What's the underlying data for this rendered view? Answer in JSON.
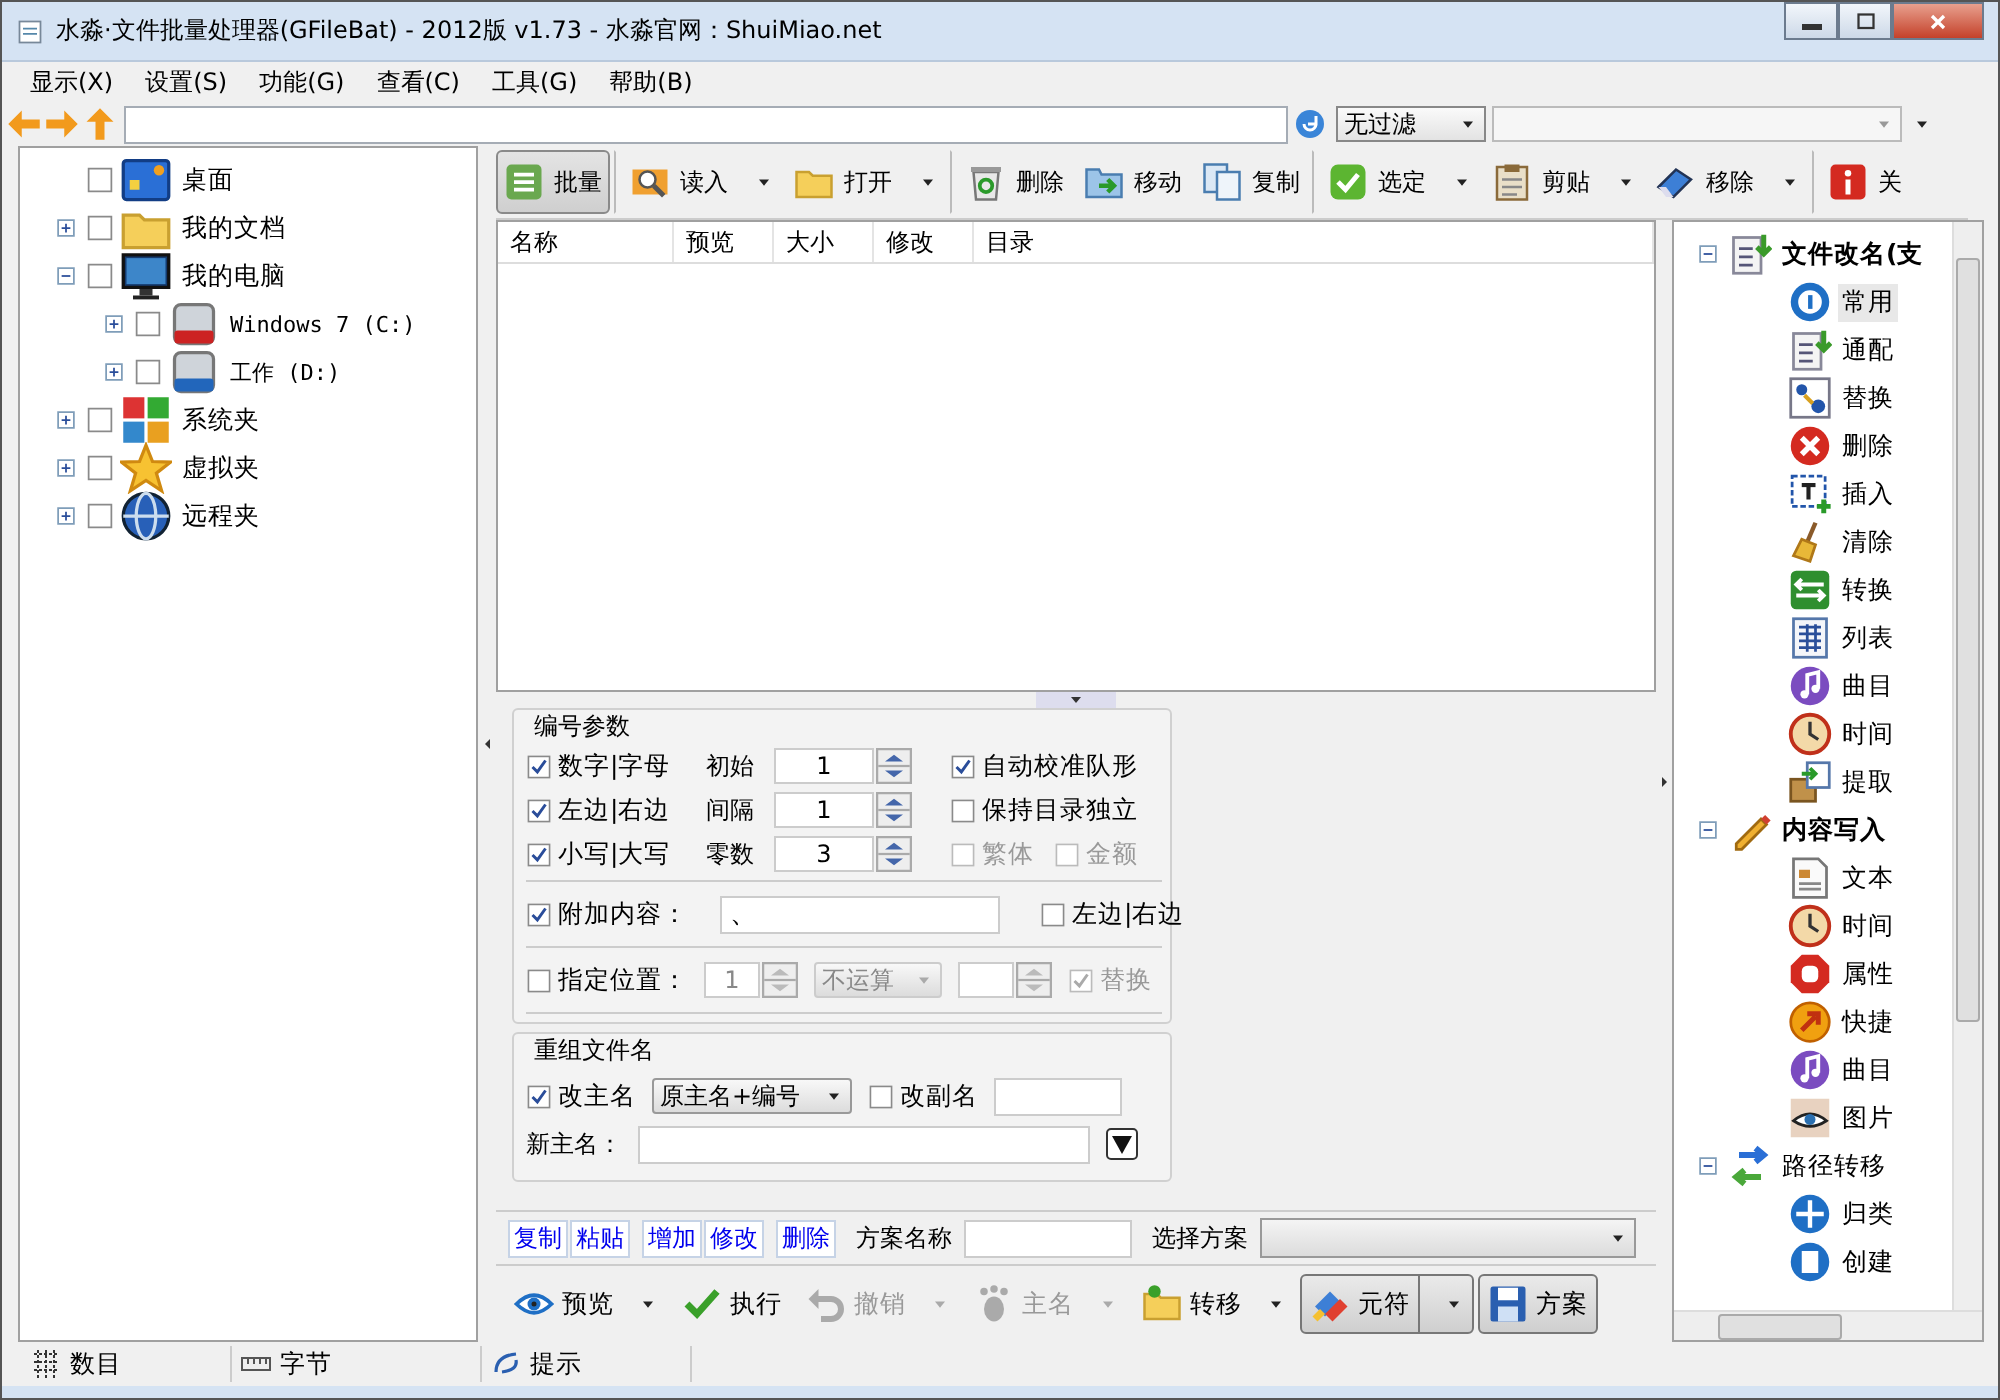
{
  "window": {
    "title": "水淼·文件批量处理器(GFileBat) - 2012版 v1.73 - 水淼官网：ShuiMiao.net"
  },
  "menu": [
    "显示(X)",
    "设置(S)",
    "功能(G)",
    "查看(C)",
    "工具(G)",
    "帮助(B)"
  ],
  "filter": {
    "value": "无过滤"
  },
  "folder_tree": [
    {
      "label": "桌面",
      "kind": "desktop",
      "checked": false
    },
    {
      "label": "我的文档",
      "kind": "folder",
      "checked": false,
      "expanded": false
    },
    {
      "label": "我的电脑",
      "kind": "monitor",
      "checked": false,
      "expanded": true,
      "children": [
        {
          "label": "Windows 7 (C:)",
          "kind": "drive-red",
          "checked": false,
          "expanded": false
        },
        {
          "label": "工作 (D:)",
          "kind": "drive-blue",
          "checked": false,
          "expanded": false
        }
      ]
    },
    {
      "label": "系统夹",
      "kind": "windows",
      "checked": false,
      "expanded": false
    },
    {
      "label": "虚拟夹",
      "kind": "star",
      "checked": false,
      "expanded": false
    },
    {
      "label": "远程夹",
      "kind": "globe",
      "checked": false,
      "expanded": false
    }
  ],
  "toolbar": [
    {
      "label": "批量",
      "kind": "list",
      "menu": false,
      "selected": true,
      "separator": false
    },
    {
      "label": "读入",
      "kind": "magnifier",
      "menu": true,
      "selected": false,
      "separator": true
    },
    {
      "label": "打开",
      "kind": "folder",
      "menu": true,
      "selected": false,
      "separator": false
    },
    {
      "label": "删除",
      "kind": "recycle",
      "menu": false,
      "selected": false,
      "separator": true
    },
    {
      "label": "移动",
      "kind": "move",
      "menu": false,
      "selected": false,
      "separator": false
    },
    {
      "label": "复制",
      "kind": "copy",
      "menu": false,
      "selected": false,
      "separator": false
    },
    {
      "label": "选定",
      "kind": "check",
      "menu": true,
      "selected": false,
      "separator": true
    },
    {
      "label": "剪贴",
      "kind": "clipboard",
      "menu": true,
      "selected": false,
      "separator": false
    },
    {
      "label": "移除",
      "kind": "eraser",
      "menu": true,
      "selected": false,
      "separator": false
    },
    {
      "label": "关",
      "kind": "info",
      "menu": false,
      "selected": false,
      "separator": true
    }
  ],
  "file_list": {
    "columns": [
      "名称",
      "预览",
      "大小",
      "修改",
      "目录"
    ]
  },
  "numbering": {
    "title": "编号参数",
    "rows": [
      {
        "option": {
          "label": "数字|字母",
          "checked": true
        },
        "field_label": "初始",
        "value": "1",
        "extras": [
          {
            "label": "自动校准队形",
            "checked": true,
            "disabled": false
          }
        ]
      },
      {
        "option": {
          "label": "左边|右边",
          "checked": true
        },
        "field_label": "间隔",
        "value": "1",
        "extras": [
          {
            "label": "保持目录独立",
            "checked": false,
            "disabled": false
          }
        ]
      },
      {
        "option": {
          "label": "小写|大写",
          "checked": true
        },
        "field_label": "零数",
        "value": "3",
        "extras": [
          {
            "label": "繁体",
            "checked": false,
            "disabled": true
          },
          {
            "label": "金额",
            "checked": false,
            "disabled": true
          }
        ]
      }
    ]
  },
  "append": {
    "option": {
      "label": "附加内容：",
      "checked": true
    },
    "value": "、",
    "side": {
      "label": "左边|右边",
      "checked": false,
      "disabled": false
    }
  },
  "position": {
    "option": {
      "label": "指定位置：",
      "checked": false
    },
    "value": "1",
    "operation": "不运算",
    "replace": {
      "label": "替换",
      "checked": true,
      "disabled": true
    }
  },
  "rename": {
    "title": "重组文件名",
    "main": {
      "label": "改主名",
      "checked": true
    },
    "pattern": "原主名+编号",
    "ext": {
      "label": "改副名",
      "checked": false
    },
    "new_name_label": "新主名："
  },
  "scheme": {
    "actions": [
      [
        "复制",
        "粘贴"
      ],
      [
        "增加",
        "修改"
      ],
      [
        "删除"
      ]
    ],
    "name_label": "方案名称",
    "select_label": "选择方案"
  },
  "bottom_toolbar": [
    {
      "label": "预览",
      "kind": "eye",
      "menu": true,
      "disabled": false,
      "selected": false
    },
    {
      "label": "执行",
      "kind": "tick",
      "menu": false,
      "disabled": false,
      "selected": false
    },
    {
      "label": "撤销",
      "kind": "undo",
      "menu": true,
      "disabled": true,
      "selected": false
    },
    {
      "label": "主名",
      "kind": "footprint",
      "menu": true,
      "disabled": true,
      "selected": false
    },
    {
      "label": "转移",
      "kind": "folder-move",
      "menu": true,
      "disabled": false,
      "selected": false
    },
    {
      "label": "元符",
      "kind": "symbols",
      "menu": true,
      "disabled": false,
      "selected": true
    },
    {
      "label": "方案",
      "kind": "save",
      "menu": false,
      "disabled": false,
      "selected": true
    }
  ],
  "function_tree": [
    {
      "label": "文件改名(支",
      "kind": "rename",
      "bold": true,
      "expanded": true,
      "children": [
        {
          "label": "常用",
          "kind": "number",
          "selected": true
        },
        {
          "label": "通配",
          "kind": "rename",
          "selected": false
        },
        {
          "label": "替换",
          "kind": "replace",
          "selected": false
        },
        {
          "label": "删除",
          "kind": "delete",
          "selected": false
        },
        {
          "label": "插入",
          "kind": "insert",
          "selected": false
        },
        {
          "label": "清除",
          "kind": "broom",
          "selected": false
        },
        {
          "label": "转换",
          "kind": "convert",
          "selected": false
        },
        {
          "label": "列表",
          "kind": "table",
          "selected": false
        },
        {
          "label": "曲目",
          "kind": "music",
          "selected": false
        },
        {
          "label": "时间",
          "kind": "clock",
          "selected": false
        },
        {
          "label": "提取",
          "kind": "extract",
          "selected": false
        }
      ]
    },
    {
      "label": "内容写入",
      "kind": "pencil",
      "bold": true,
      "expanded": true,
      "children": [
        {
          "label": "文本",
          "kind": "text",
          "selected": false
        },
        {
          "label": "时间",
          "kind": "clock",
          "selected": false
        },
        {
          "label": "属性",
          "kind": "hand",
          "selected": false
        },
        {
          "label": "快捷",
          "kind": "shortcut",
          "selected": false
        },
        {
          "label": "曲目",
          "kind": "music",
          "selected": false
        },
        {
          "label": "图片",
          "kind": "picture",
          "selected": false
        }
      ]
    },
    {
      "label": "路径转移",
      "kind": "path",
      "bold": false,
      "expanded": true,
      "children": [
        {
          "label": "归类",
          "kind": "categorize",
          "selected": false
        },
        {
          "label": "创建",
          "kind": "create",
          "selected": false
        }
      ]
    }
  ],
  "status_bar": [
    {
      "label": "数目",
      "kind": "grid"
    },
    {
      "label": "字节",
      "kind": "ruler"
    },
    {
      "label": "提示",
      "kind": "hint"
    }
  ]
}
